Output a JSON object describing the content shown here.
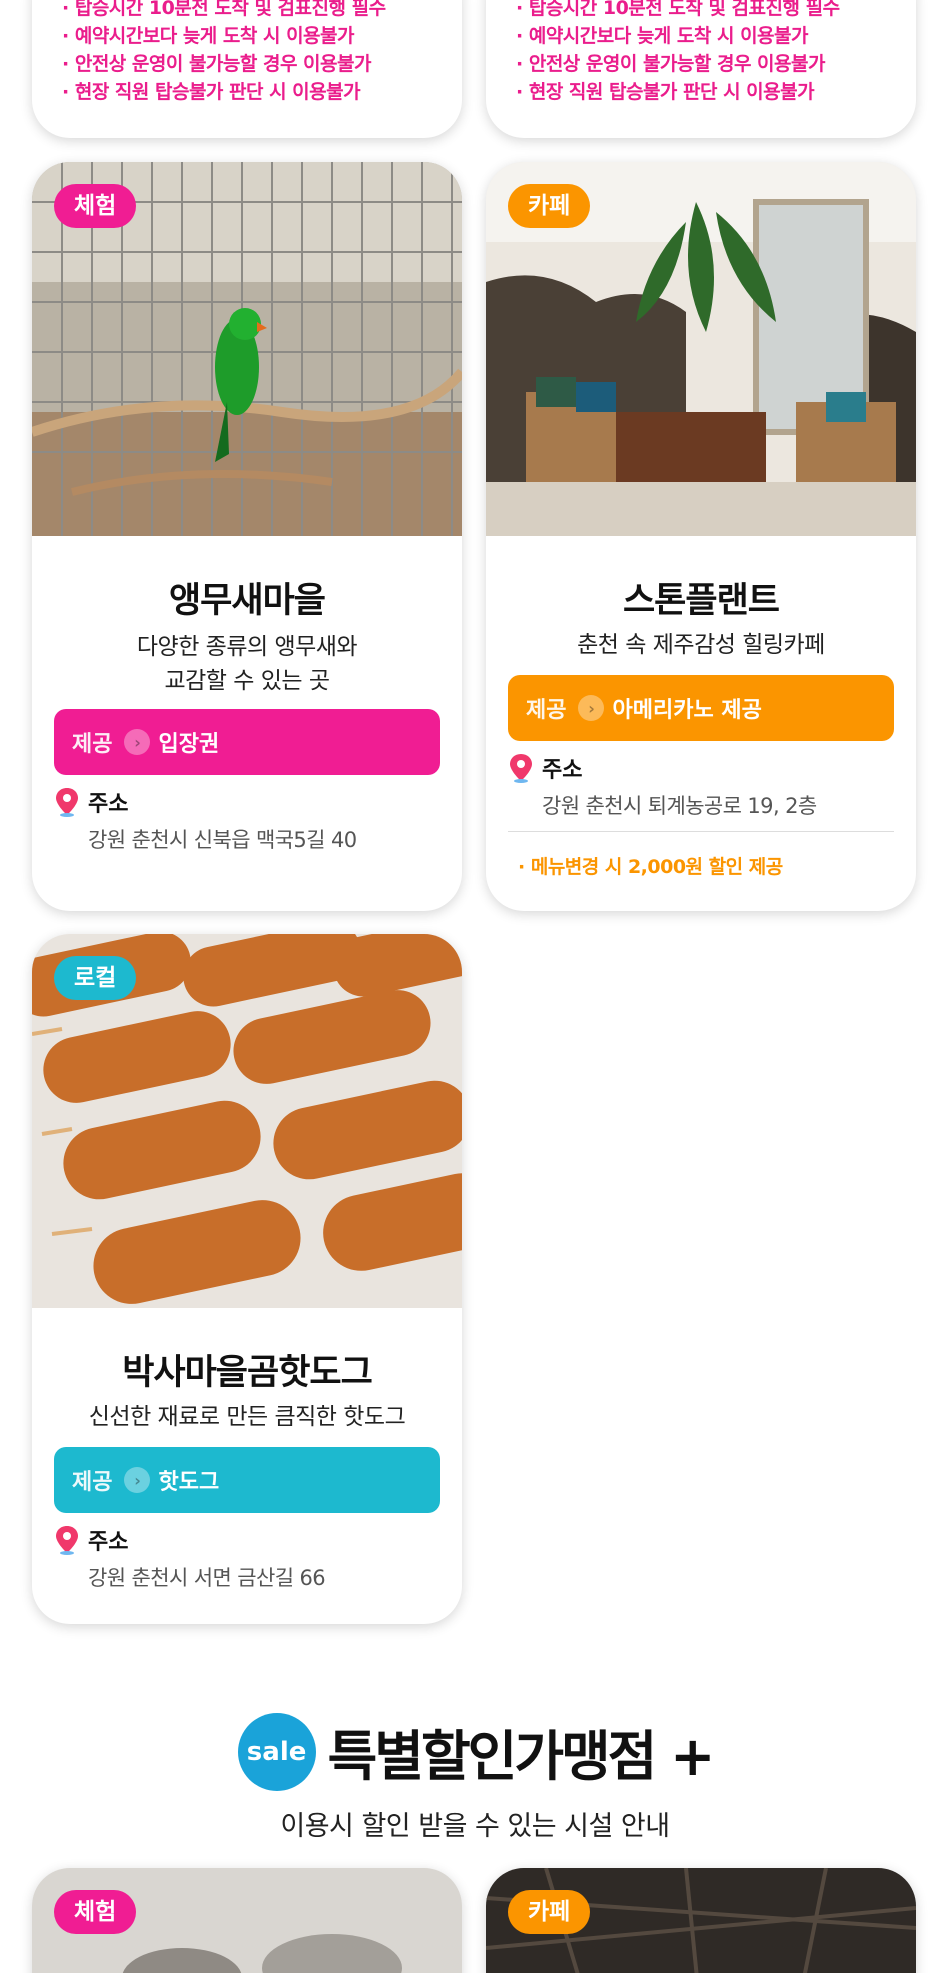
{
  "top_cards": {
    "left": {
      "rules": [
        "· 탑승시간 10분전 도착 및 검표진행 필수",
        "· 예약시간보다 늦게 도착 시 이용불가",
        "· 안전상 운영이 불가능할 경우 이용불가",
        "· 현장 직원 탑승불가 판단 시 이용불가"
      ]
    },
    "right": {
      "rules": [
        "· 탑승시간 10분전 도착 및 검표진행 필수",
        "· 예약시간보다 늦게 도착 시 이용불가",
        "· 안전상 운영이 불가능할 경우 이용불가",
        "· 현장 직원 탑승불가 판단 시 이용불가"
      ]
    }
  },
  "cards": [
    {
      "tag": "체험",
      "title": "앵무새마을",
      "desc_line1": "다양한 종류의 앵무새와",
      "desc_line2": "교감할 수 있는 곳",
      "offer_label": "제공",
      "offer_value": "입장권",
      "address_label": "주소",
      "address": "강원 춘천시 신북읍 맥국5길 40",
      "photo_icon": "parrot-cage-photo"
    },
    {
      "tag": "카페",
      "title": "스톤플랜트",
      "desc_line1": "춘천 속 제주감성 힐링카페",
      "offer_label": "제공",
      "offer_value": "아메리카노 제공",
      "address_label": "주소",
      "address": "강원 춘천시 퇴계농공로 19, 2층",
      "note": "· 메뉴변경 시 2,000원 할인 제공",
      "photo_icon": "stone-cafe-photo"
    },
    {
      "tag": "로컬",
      "title": "박사마을곰핫도그",
      "desc_line1": "신선한 재료로 만든 큼직한 핫도그",
      "offer_label": "제공",
      "offer_value": "핫도그",
      "address_label": "주소",
      "address": "강원 춘천시 서면 금산길 66",
      "photo_icon": "hotdog-photo"
    }
  ],
  "sale_section": {
    "badge": "sale",
    "title": "특별할인가맹점 +",
    "subtitle": "이용시 할인 받을 수 있는 시설 안내"
  },
  "bottom_cards": [
    {
      "tag": "체험"
    },
    {
      "tag": "카페"
    }
  ],
  "colors": {
    "pink": "#f01d93",
    "orange": "#fb9500",
    "cyan": "#1db9cf",
    "sale_blue": "#1aa3d9"
  }
}
